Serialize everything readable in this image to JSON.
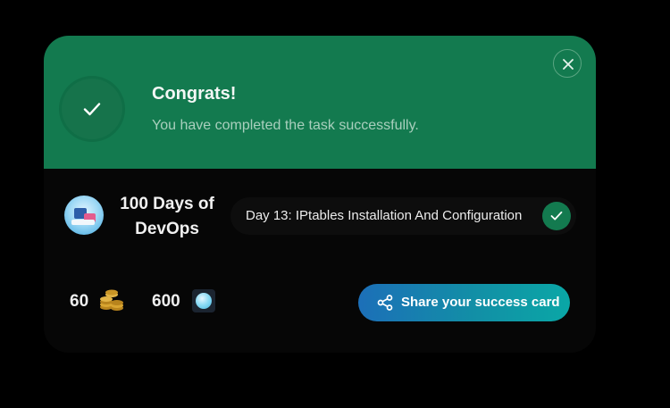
{
  "header": {
    "title": "Congrats!",
    "subtitle": "You have completed the task successfully."
  },
  "course": {
    "title": "100 Days of DevOps",
    "task": "Day 13: IPtables Installation And Configuration"
  },
  "rewards": {
    "coins": "60",
    "gems": "600"
  },
  "share_button": {
    "label": "Share your success card"
  },
  "icons": {
    "success": "check-icon",
    "close": "close-icon",
    "task_done": "check-icon",
    "coins": "coins-icon",
    "gems": "gem-icon",
    "share": "share-icon"
  },
  "colors": {
    "header_bg": "#137a4f",
    "panel_bg": "#060606",
    "share_gradient_start": "#1c6fb8",
    "share_gradient_end": "#0aa7a6"
  }
}
